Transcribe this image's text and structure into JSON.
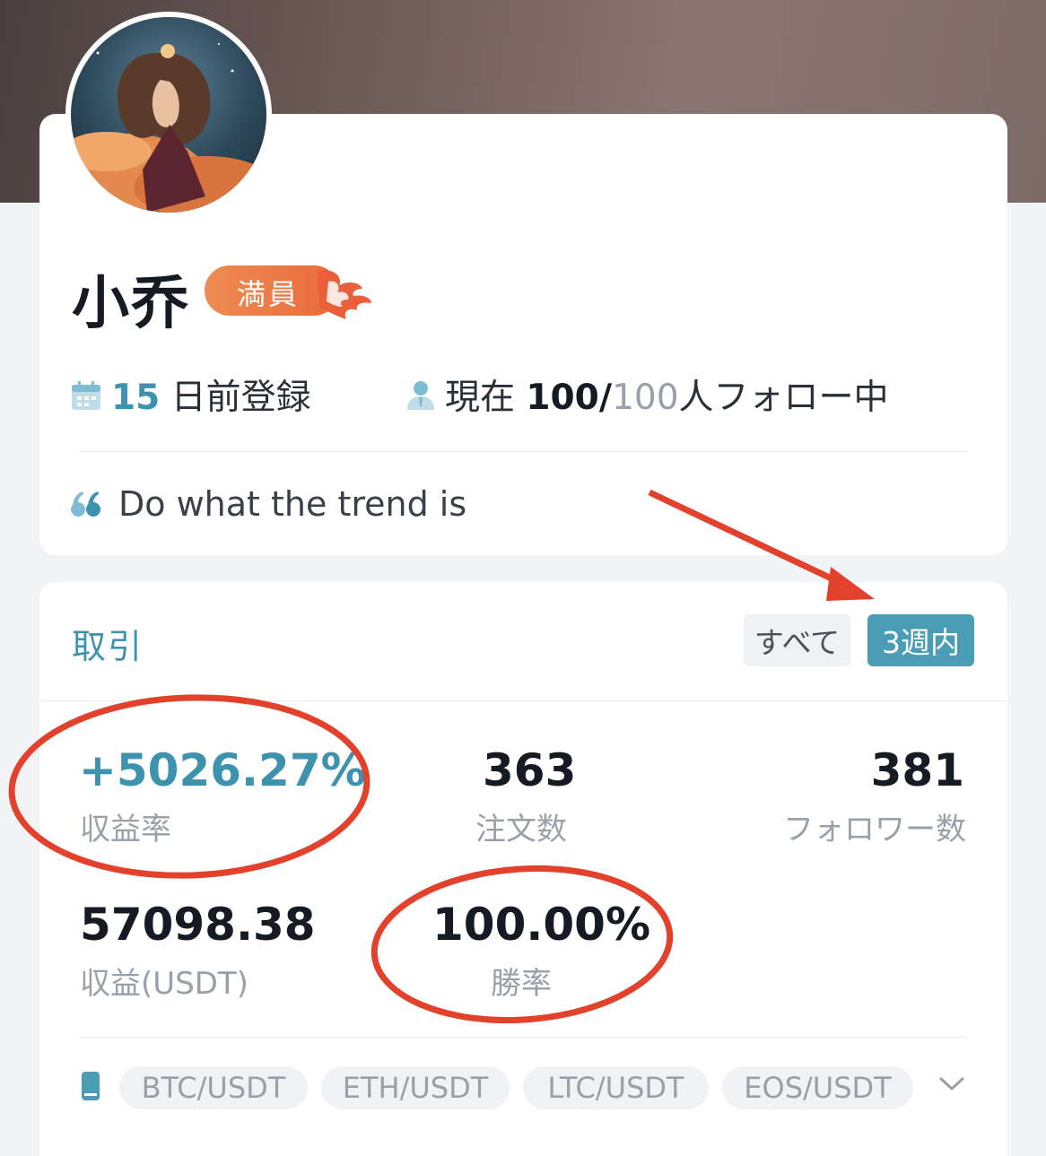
{
  "profile": {
    "name": "小乔",
    "badge": "満員",
    "registered_days": "15",
    "registered_suffix": " 日前登録",
    "following_prefix": "現在 ",
    "following_current": "100",
    "following_sep": "/",
    "following_max": "100",
    "following_suffix": "人フォロー中",
    "bio": "Do what the trend is"
  },
  "trading": {
    "section_title": "取引",
    "filters": [
      {
        "label": "すべて",
        "active": false
      },
      {
        "label": "3週内",
        "active": true
      }
    ],
    "stats": {
      "roi_value": "+5026.27%",
      "roi_label": "収益率",
      "orders_value": "363",
      "orders_label": "注文数",
      "followers_value": "381",
      "followers_label": "フォロワー数",
      "profit_value": "57098.38",
      "profit_label": "収益(USDT)",
      "winrate_value": "100.00%",
      "winrate_label": "勝率"
    },
    "pairs": [
      "BTC/USDT",
      "ETH/USDT",
      "LTC/USDT",
      "EOS/USDT"
    ]
  },
  "colors": {
    "accent": "#3d93ad",
    "badge": "#e96a3c",
    "annotation": "#e2412c"
  },
  "icons": {
    "calendar": "calendar-icon",
    "user": "user-icon",
    "quote": "quote-icon",
    "pair": "phone-icon",
    "expand": "chevron-down-icon"
  }
}
